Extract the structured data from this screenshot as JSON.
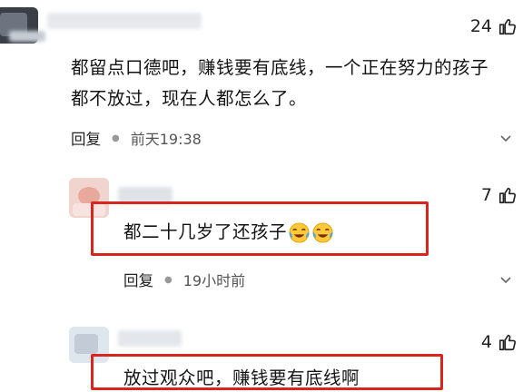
{
  "comments": [
    {
      "likes": "24",
      "text_lines": [
        "都留点口德吧，赚钱要有底线，一个正在努力的孩子",
        "都不放过，现在人都怎么了。"
      ],
      "reply_label": "回复",
      "time": "前天19:38"
    },
    {
      "likes": "7",
      "text": "都二十几岁了还孩子",
      "reply_label": "回复",
      "time": "19小时前"
    },
    {
      "likes": "4",
      "text": "放过观众吧，赚钱要有底线啊"
    }
  ],
  "icons": {
    "like": "thumbs-up-icon",
    "more": "chevron-down-icon",
    "emoji": "crying-laughing-emoji"
  },
  "colors": {
    "highlight_border": "#d7261e",
    "text": "#141414",
    "meta": "#555555"
  }
}
